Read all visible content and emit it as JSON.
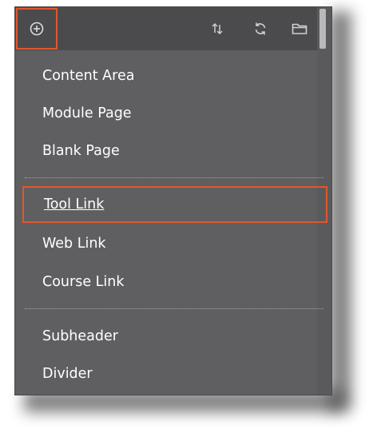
{
  "toolbar": {
    "add_icon": "plus-circle-icon",
    "sort_icon": "sort-arrows-icon",
    "refresh_icon": "refresh-icon",
    "folder_icon": "folder-icon"
  },
  "menu": {
    "groups": [
      [
        "Content Area",
        "Module Page",
        "Blank Page"
      ],
      [
        "Tool Link",
        "Web Link",
        "Course Link"
      ],
      [
        "Subheader",
        "Divider"
      ]
    ],
    "highlighted_item": "Tool Link"
  },
  "colors": {
    "panel_bg": "#5f5f61",
    "toolbar_bg": "#4b4b4d",
    "highlight_border": "#e0582a",
    "text": "#ffffff"
  }
}
